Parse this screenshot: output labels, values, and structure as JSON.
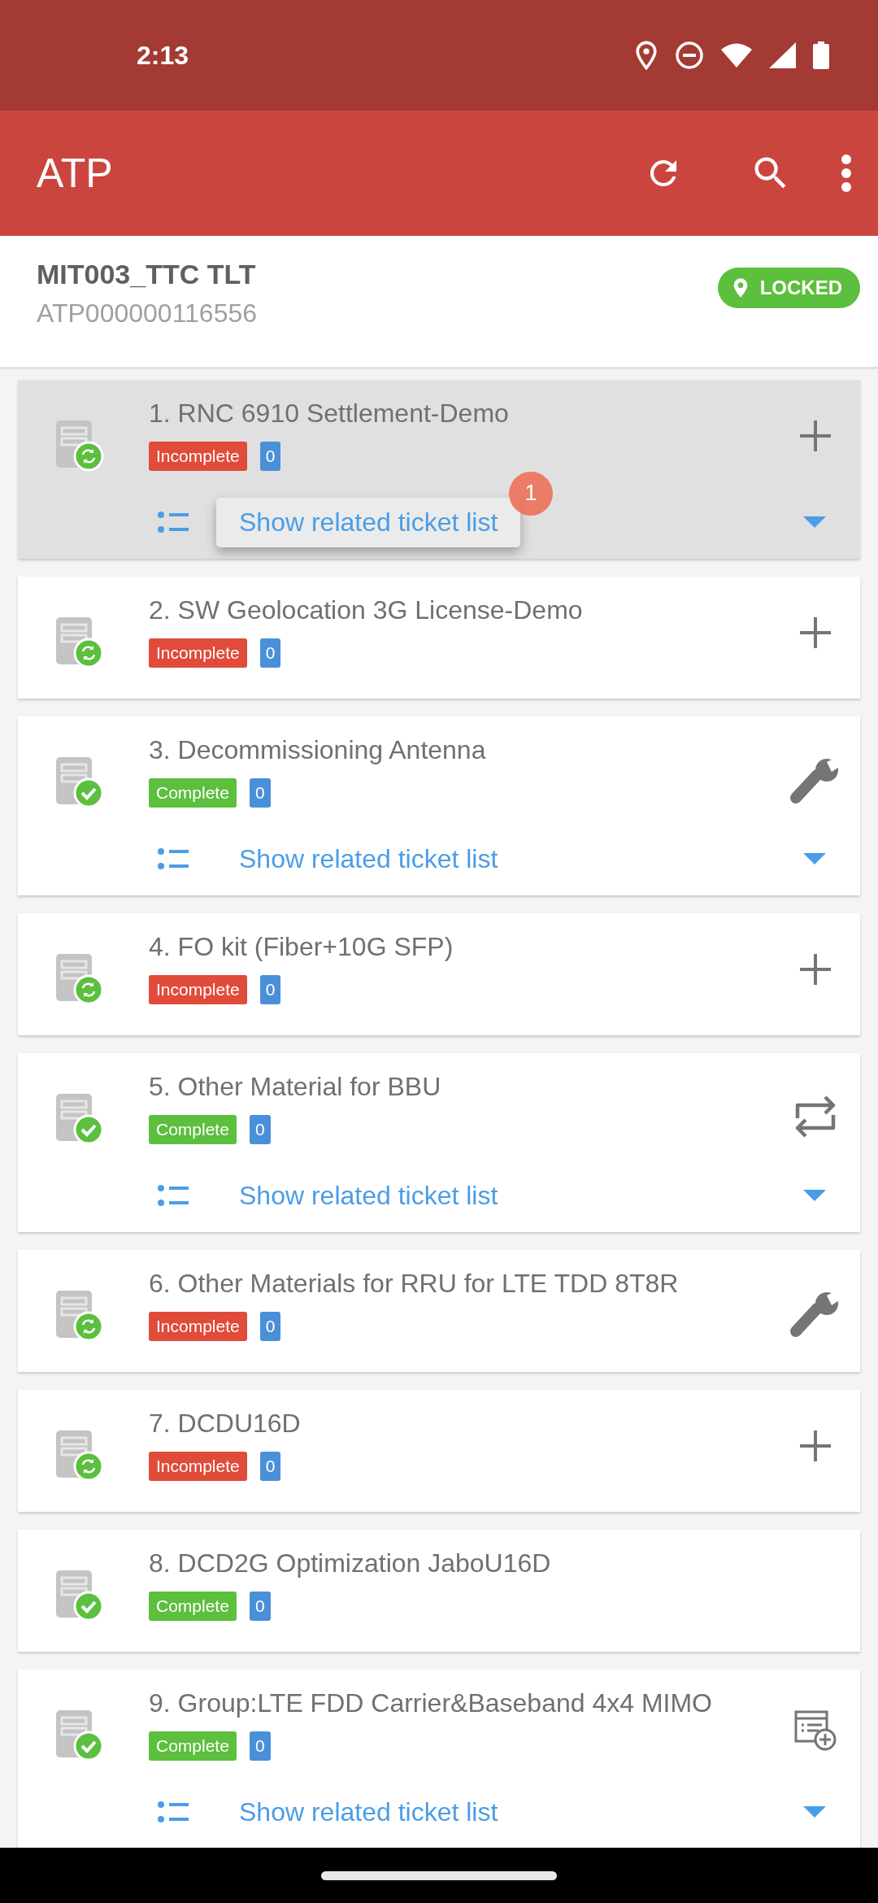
{
  "status_bar": {
    "time": "2:13"
  },
  "app_bar": {
    "title": "ATP"
  },
  "header": {
    "title": "MIT003_TTC TLT",
    "subtitle": "ATP000000116556",
    "lock_badge": "LOCKED"
  },
  "items": [
    {
      "title": "1. RNC 6910 Settlement-Demo",
      "status": {
        "kind": "incomplete",
        "label": "Incomplete"
      },
      "count": "0",
      "action": {
        "kind": "add"
      },
      "selected": true,
      "ticket_link": {
        "label": "Show related ticket list",
        "popup": true,
        "badge": "1"
      }
    },
    {
      "title": "2. SW Geolocation 3G License-Demo",
      "status": {
        "kind": "incomplete",
        "label": "Incomplete"
      },
      "count": "0",
      "action": {
        "kind": "add"
      },
      "selected": false
    },
    {
      "title": "3. Decommissioning Antenna",
      "status": {
        "kind": "complete",
        "label": "Complete"
      },
      "count": "0",
      "action": {
        "kind": "wrench"
      },
      "selected": false,
      "ticket_link": {
        "label": "Show related ticket list",
        "popup": false
      }
    },
    {
      "title": "4. FO kit (Fiber+10G SFP)",
      "status": {
        "kind": "incomplete",
        "label": "Incomplete"
      },
      "count": "0",
      "action": {
        "kind": "add"
      },
      "selected": false
    },
    {
      "title": "5. Other Material for BBU",
      "status": {
        "kind": "complete",
        "label": "Complete"
      },
      "count": "0",
      "action": {
        "kind": "swap"
      },
      "selected": false,
      "ticket_link": {
        "label": "Show related ticket list",
        "popup": false
      }
    },
    {
      "title": "6. Other Materials for RRU for LTE TDD 8T8R",
      "status": {
        "kind": "incomplete",
        "label": "Incomplete"
      },
      "count": "0",
      "action": {
        "kind": "wrench"
      },
      "selected": false
    },
    {
      "title": "7. DCDU16D",
      "status": {
        "kind": "incomplete",
        "label": "Incomplete"
      },
      "count": "0",
      "action": {
        "kind": "add"
      },
      "selected": false
    },
    {
      "title": "8. DCD2G Optimization JaboU16D",
      "status": {
        "kind": "complete",
        "label": "Complete"
      },
      "count": "0",
      "selected": false
    },
    {
      "title": "9. Group:LTE FDD Carrier&Baseband 4x4 MIMO",
      "status": {
        "kind": "complete",
        "label": "Complete"
      },
      "count": "0",
      "action": {
        "kind": "form-add"
      },
      "selected": false,
      "ticket_link": {
        "label": "Show related ticket list",
        "popup": false
      }
    }
  ]
}
